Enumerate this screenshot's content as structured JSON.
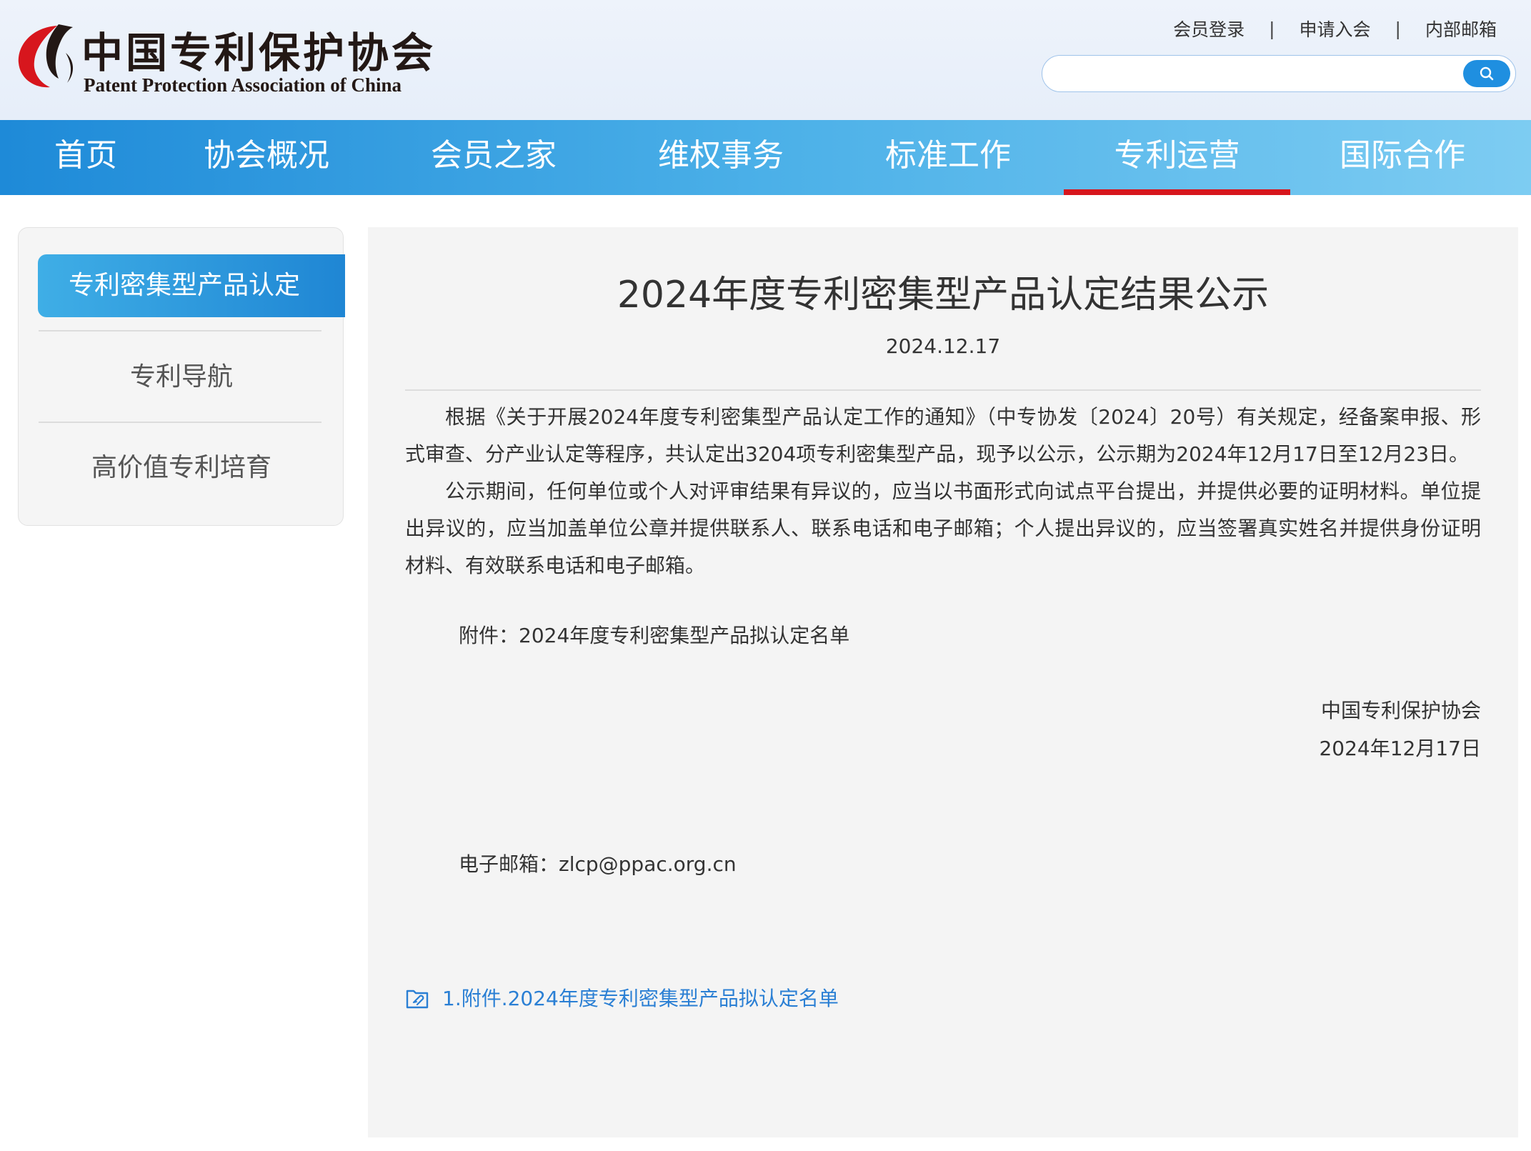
{
  "header": {
    "logo_cn": "中国专利保护协会",
    "logo_en": "Patent Protection Association of China",
    "top_links": {
      "member_login": "会员登录",
      "apply_join": "申请入会",
      "internal_mail": "内部邮箱",
      "separator": "|"
    },
    "search": {
      "value": "",
      "placeholder": ""
    }
  },
  "nav": {
    "items": [
      "首页",
      "协会概况",
      "会员之家",
      "维权事务",
      "标准工作",
      "专利运营",
      "国际合作"
    ],
    "active": "专利运营"
  },
  "sidebar": {
    "items": [
      "专利密集型产品认定",
      "专利导航",
      "高价值专利培育"
    ],
    "active": "专利密集型产品认定"
  },
  "article": {
    "title": "2024年度专利密集型产品认定结果公示",
    "date": "2024.12.17",
    "paragraphs": [
      "根据《关于开展2024年度专利密集型产品认定工作的通知》（中专协发〔2024〕20号）有关规定，经备案申报、形式审查、分产业认定等程序，共认定出3204项专利密集型产品，现予以公示，公示期为2024年12月17日至12月23日。",
      "公示期间，任何单位或个人对评审结果有异议的，应当以书面形式向试点平台提出，并提供必要的证明材料。单位提出异议的，应当加盖单位公章并提供联系人、联系电话和电子邮箱；个人提出异议的，应当签署真实姓名并提供身份证明材料、有效联系电话和电子邮箱。"
    ],
    "attachment_note": "附件：2024年度专利密集型产品拟认定名单",
    "signature_org": "中国专利保护协会",
    "signature_date": "2024年12月17日",
    "email": "电子邮箱：zlcp@ppac.org.cn",
    "attachment_link": "1.附件.2024年度专利密集型产品拟认定名单"
  },
  "colors": {
    "nav_gradient_start": "#1e8ad8",
    "nav_gradient_end": "#7dccf2",
    "nav_active_underline": "#d7161d",
    "sidebar_active": "#2a94dc",
    "link": "#2a7fd4",
    "logo_red": "#d7161d"
  },
  "icons": {
    "logo": "ppac-logo-mark",
    "search": "search-icon",
    "attachment": "attachment-file-icon"
  }
}
